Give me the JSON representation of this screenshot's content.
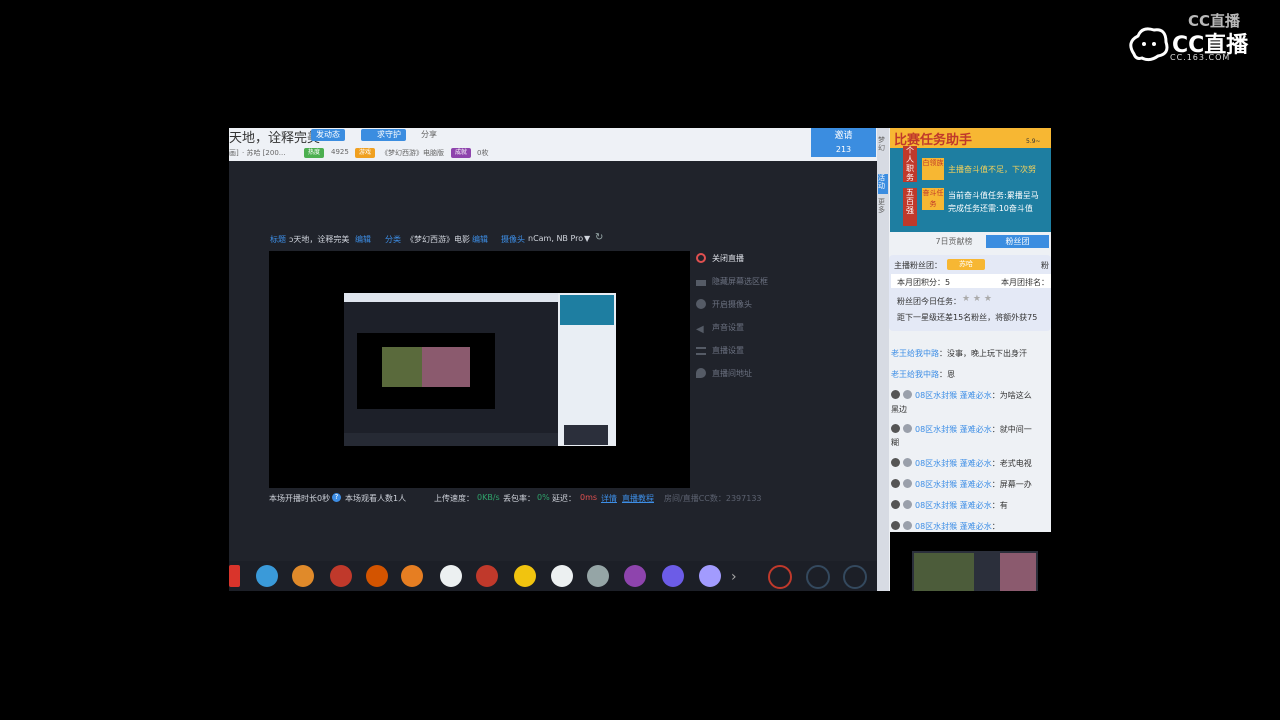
{
  "watermark": {
    "small": "CC直播",
    "brand": "CC直播",
    "url": "CC.163.COM"
  },
  "header": {
    "title": "天地，诠释完美",
    "btn_follow": "发动态",
    "btn_guard": "求守护",
    "share": "分享",
    "info_prefix": "画]",
    "info_text": "· 苏哈 [200...",
    "tag_hot": "热度",
    "hot_value": "4925",
    "tag_game": "游戏",
    "game_name": "《梦幻西游》电脑版",
    "tag_achievement": "成就",
    "achievement_value": "0枚",
    "invite_label": "邀请",
    "invite_count": "213"
  },
  "settings": {
    "title_label": "标题",
    "title_value": "ɔ天地，诠释完美",
    "edit": "编辑",
    "category_label": "分类",
    "category_value": "《梦幻西游》电影",
    "camera_label": "摄像头",
    "camera_value": "nCam, NB Pro"
  },
  "side_menu": [
    {
      "label": "关闭直播"
    },
    {
      "label": "隐藏屏幕选区框"
    },
    {
      "label": "开启摄像头"
    },
    {
      "label": "声音设置"
    },
    {
      "label": "直播设置"
    },
    {
      "label": "直播间地址"
    }
  ],
  "stats": {
    "duration": "本场开播时长0秒",
    "viewers": "本场观看人数1人",
    "upload_label": "上传速度：",
    "upload_value": "0KB/s",
    "loss_label": "丢包率：",
    "loss_value": "0%",
    "delay_label": "延迟：",
    "delay_value": "0ms",
    "detail": "详情",
    "tutorial": "直播教程",
    "room_cc": "房间/直播CC数：2397133"
  },
  "banner": {
    "headline": "比赛任务助手",
    "date": "5.9~",
    "tab_personal": "个人职务",
    "tab_five": "五百强",
    "row1_icon": "白领族",
    "row1_text": "主播奋斗值不足，下次努",
    "row2_icon": "奋斗任务",
    "row2_text": "当前奋斗值任务:累播呈马",
    "row3_text": "完成任务还需:10奋斗值"
  },
  "side_tabs": [
    "梦幻",
    "活动",
    "更多"
  ],
  "fan_tabs": {
    "rank": "7日贡献榜",
    "fans": "粉丝团"
  },
  "fan_club": {
    "host_label": "主播粉丝团：",
    "host_value": "苏哈",
    "fans_word": "粉",
    "points": "本月团积分：5",
    "rank": "本月团排名：",
    "task": "粉丝团今日任务：",
    "next": "距下一星级还差15名粉丝，将额外获75"
  },
  "chat": [
    {
      "name": "老王给我中路",
      "msg": "：没事，晚上玩下出身汗"
    },
    {
      "name": "老王给我中路",
      "msg": "：恩"
    },
    {
      "name": "08区水封猴 蓬难必水",
      "msg": "：为啥这么",
      "msg2": "黑边"
    },
    {
      "name": "08区水封猴 蓬难必水",
      "msg": "：就中间一",
      "msg2": "糊"
    },
    {
      "name": "08区水封猴 蓬难必水",
      "msg": "：老式电视"
    },
    {
      "name": "08区水封猴 蓬难必水",
      "msg": "：屏幕一办"
    },
    {
      "name": "08区水封猴 蓬难必水",
      "msg": "：有"
    },
    {
      "name": "08区水封猴 蓬难必水",
      "msg": "："
    }
  ],
  "colors": {
    "accent": "#3d8ee6",
    "panel_dark": "#20232b",
    "banner": "#1e7ea1"
  }
}
